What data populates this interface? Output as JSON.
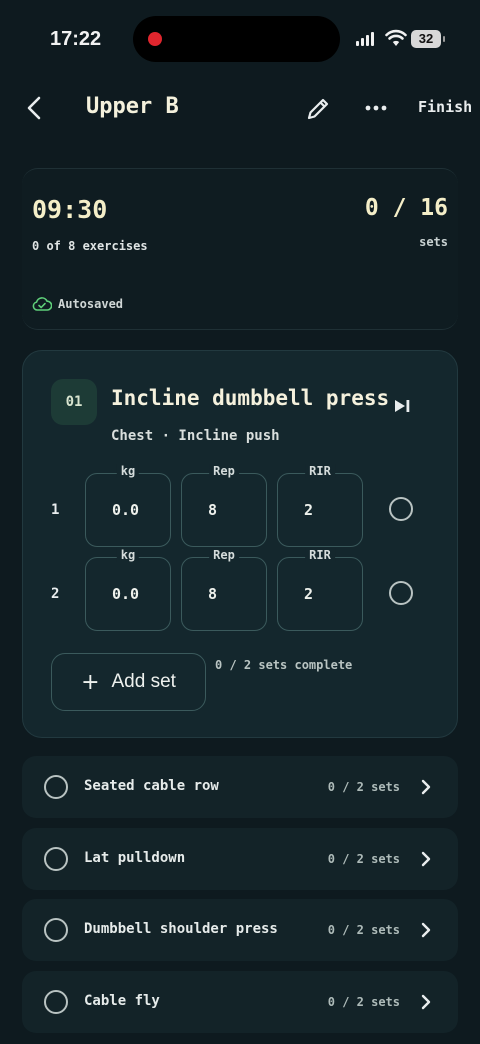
{
  "status_bar": {
    "time": "17:22",
    "battery": "32"
  },
  "header": {
    "title": "Upper B",
    "finish_label": "Finish"
  },
  "summary": {
    "timer": "09:30",
    "exercises_progress": "0 of 8 exercises",
    "sets_progress": "0 / 16",
    "sets_label": "sets",
    "autosave_label": "Autosaved"
  },
  "active_exercise": {
    "number": "01",
    "name": "Incline dumbbell press",
    "meta": "Chest · Incline push",
    "field_labels": {
      "weight": "kg",
      "reps": "Rep",
      "rir": "RIR"
    },
    "sets": [
      {
        "set_no": "1",
        "weight": "0.0",
        "reps": "8",
        "rir": "2"
      },
      {
        "set_no": "2",
        "weight": "0.0",
        "reps": "8",
        "rir": "2"
      }
    ],
    "add_set_label": "Add set",
    "sets_complete": "0 / 2 sets complete"
  },
  "exercise_list": [
    {
      "name": "Seated cable row",
      "sets": "0 / 2 sets"
    },
    {
      "name": "Lat pulldown",
      "sets": "0 / 2 sets"
    },
    {
      "name": "Dumbbell shoulder press",
      "sets": "0 / 2 sets"
    },
    {
      "name": "Cable fly",
      "sets": "0 / 2 sets"
    }
  ],
  "colors": {
    "background": "#0e1a1f",
    "accent_green": "#5fd07a",
    "title_cream": "#f4eec8"
  }
}
